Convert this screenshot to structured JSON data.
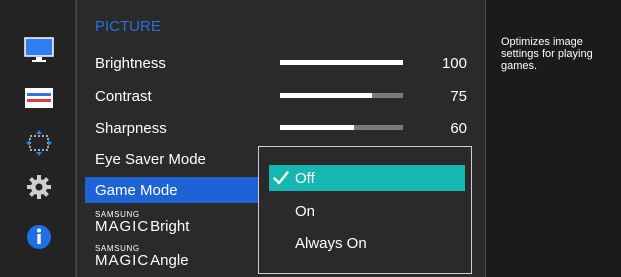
{
  "section_title": "PICTURE",
  "menu": {
    "items": [
      {
        "label": "Brightness",
        "value": "100",
        "level": 1.0
      },
      {
        "label": "Contrast",
        "value": "75",
        "level": 0.75
      },
      {
        "label": "Sharpness",
        "value": "60",
        "level": 0.6
      },
      {
        "label": "Eye Saver Mode"
      },
      {
        "label": "Game Mode",
        "selected": true
      },
      {
        "brand": "SAMSUNG",
        "magic": "MAGIC",
        "label": "Bright"
      },
      {
        "brand": "SAMSUNG",
        "magic": "MAGIC",
        "label": "Angle"
      }
    ]
  },
  "dropdown": {
    "options": [
      "Off",
      "On",
      "Always On"
    ],
    "selected": "Off",
    "check_icon": "checkmark-icon"
  },
  "help": {
    "text": "Optimizes image settings for playing games."
  },
  "nav": {
    "icons": [
      "monitor-icon",
      "picture-settings-icon",
      "size-position-icon",
      "gear-icon",
      "info-icon"
    ]
  },
  "colors": {
    "selected_row": "#1e63d6",
    "dropdown_selected": "#16b7b2",
    "section_title": "#2b6fe0",
    "info_icon": "#1f6fe6"
  }
}
